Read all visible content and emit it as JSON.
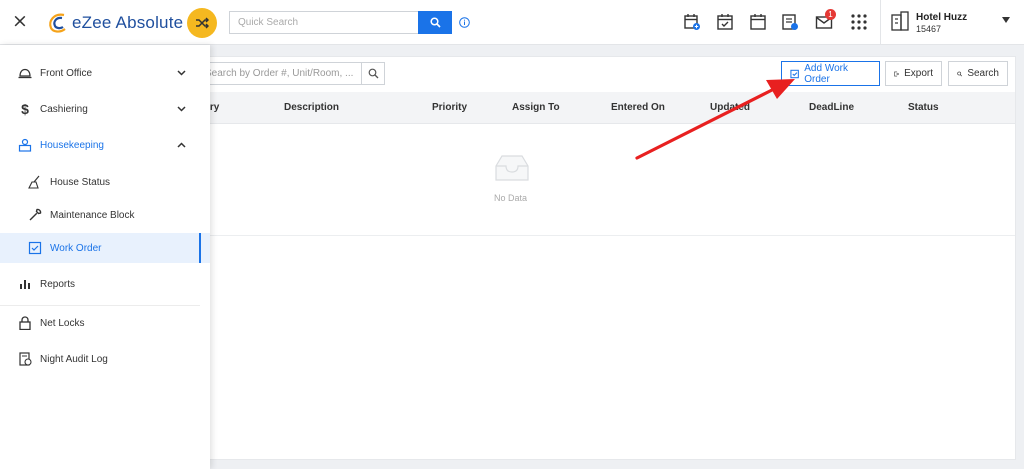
{
  "header": {
    "close_glyph": "×",
    "app_name": "eZee Absolute",
    "search_placeholder": "Quick Search",
    "icons": [
      "calendar-add-icon",
      "calendar-check-icon",
      "calendar-icon",
      "notes-icon",
      "mail-icon",
      "apps-grid-icon"
    ],
    "mail_badge": "1",
    "hotel_name": "Hotel Huzz",
    "hotel_code": "15467"
  },
  "sidebar": {
    "items": [
      {
        "label": "Front Office",
        "icon": "bell-icon"
      },
      {
        "label": "Cashiering",
        "icon": "dollar-icon"
      },
      {
        "label": "Housekeeping",
        "icon": "housekeeping-icon"
      },
      {
        "label": "House Status",
        "icon": "broom-icon"
      },
      {
        "label": "Maintenance Block",
        "icon": "wrench-icon"
      },
      {
        "label": "Work Order",
        "icon": "checkbox-icon"
      },
      {
        "label": "Reports",
        "icon": "bar-chart-icon"
      },
      {
        "label": "Net Locks",
        "icon": "lock-icon"
      },
      {
        "label": "Night Audit Log",
        "icon": "audit-icon"
      }
    ]
  },
  "toolbar": {
    "filter_placeholder": "Search by Order #, Unit/Room, ...",
    "add_label": "Add Work Order",
    "export_label": "Export",
    "search_label": "Search"
  },
  "table": {
    "columns": [
      "Category",
      "Description",
      "Priority",
      "Assign To",
      "Entered On",
      "Updated",
      "DeadLine",
      "Status"
    ],
    "empty_text": "No Data"
  },
  "colors": {
    "accent": "#1a73e8",
    "brand_yellow": "#f5b820",
    "annotation_red": "#e82020"
  }
}
